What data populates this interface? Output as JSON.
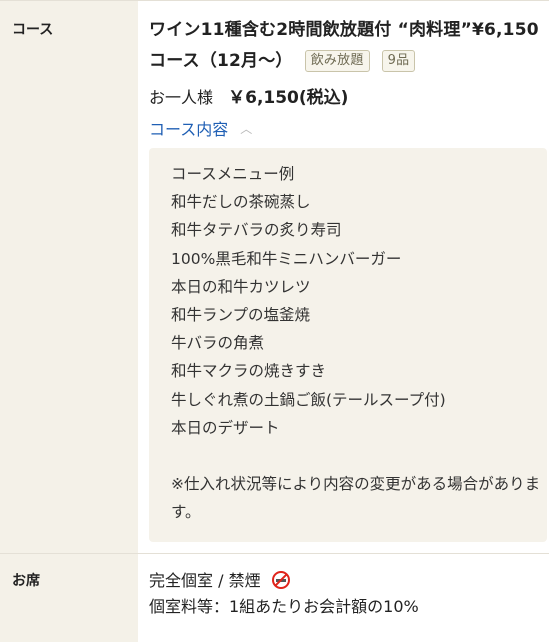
{
  "course": {
    "label": "コース",
    "title": "ワイン11種含む2時間飲放題付 “肉料理”¥6,150コース（12月〜）",
    "tags": [
      "飲み放題",
      "9品"
    ],
    "price_prefix": "お一人様",
    "price": "￥6,150(税込)",
    "toggle_label": "コース内容",
    "menu_items": [
      "コースメニュー例",
      "和牛だしの茶碗蒸し",
      "和牛タテバラの炙り寿司",
      "100%黒毛和牛ミニハンバーガー",
      "本日の和牛カツレツ",
      "和牛ランプの塩釜焼",
      "牛バラの角煮",
      "和牛マクラの焼きすき",
      "牛しぐれ煮の土鍋ご飯(テールスープ付)",
      "本日のデザート"
    ],
    "note": "※仕入れ状況等により内容の変更がある場合があります。"
  },
  "seat": {
    "label": "お席",
    "line1": "完全個室 / 禁煙",
    "line2": "個室料等：1組あたりお会計額の10%"
  },
  "icons": {
    "collapse": "chevron-up-icon",
    "smoking": "no-smoking-icon"
  },
  "colors": {
    "label_bg": "#f4f1e8",
    "link": "#1f5fb4",
    "menu_bg": "#f5f2ea"
  }
}
